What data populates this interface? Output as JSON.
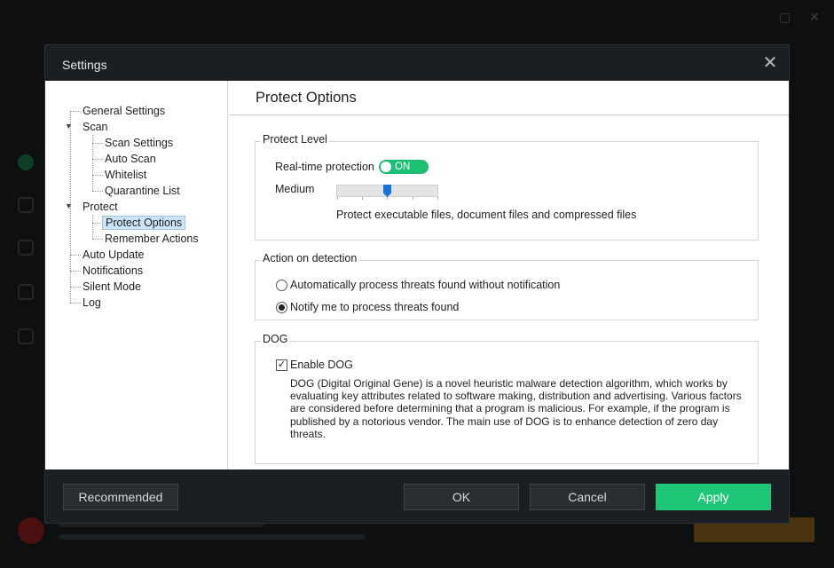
{
  "dialog": {
    "title": "Settings",
    "close_icon": "close-icon"
  },
  "tree": {
    "items": [
      {
        "label": "General Settings"
      },
      {
        "label": "Scan",
        "expanded": true
      },
      {
        "label": "Scan Settings"
      },
      {
        "label": "Auto Scan"
      },
      {
        "label": "Whitelist"
      },
      {
        "label": "Quarantine List"
      },
      {
        "label": "Protect",
        "expanded": true
      },
      {
        "label": "Protect Options",
        "selected": true
      },
      {
        "label": "Remember Actions"
      },
      {
        "label": "Auto Update"
      },
      {
        "label": "Notifications"
      },
      {
        "label": "Silent Mode"
      },
      {
        "label": "Log"
      }
    ]
  },
  "panel": {
    "title": "Protect Options",
    "protect_level": {
      "legend": "Protect Level",
      "realtime_label": "Real-time protection",
      "realtime_toggle": "ON",
      "level_label": "Medium",
      "level_value": 0.5,
      "level_description": "Protect executable files, document files and compressed files"
    },
    "action": {
      "legend": "Action on detection",
      "options": [
        {
          "label": "Automatically process threats found without notification",
          "checked": false
        },
        {
          "label": "Notify me to process threats found",
          "checked": true
        }
      ]
    },
    "dog": {
      "legend": "DOG",
      "enable_label": "Enable DOG",
      "enabled": true,
      "description": "DOG (Digital Original Gene) is a novel heuristic malware detection algorithm, which works by evaluating key attributes related to software making, distribution and advertising. Various factors are considered before determining that a program is malicious. For example, if the program is published by a notorious vendor. The main use of DOG is to enhance detection of zero day threats."
    }
  },
  "footer": {
    "recommended": "Recommended",
    "ok": "OK",
    "cancel": "Cancel",
    "apply": "Apply"
  },
  "colors": {
    "accent_green": "#1ec677",
    "toggle_green": "#1dbf73",
    "slider_blue": "#1873d6",
    "dialog_bg": "#1b1e22"
  }
}
